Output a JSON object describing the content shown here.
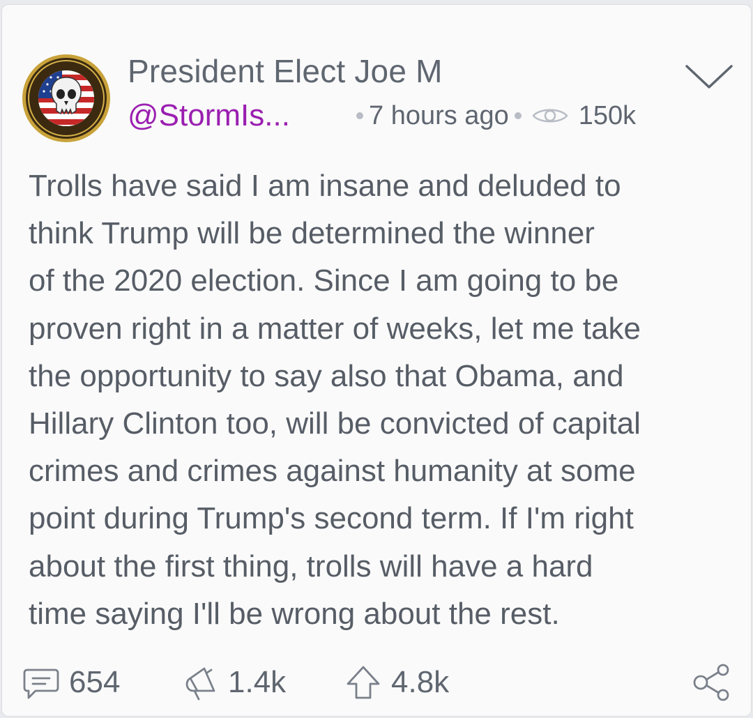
{
  "post": {
    "author_name": "President Elect Joe M",
    "handle": "@StormIs...",
    "time_ago": "7 hours ago",
    "views": "150k",
    "avatar_icon": "punisher-skull-flag-badge-icon",
    "body_lines": [
      "Trolls have said I am insane and deluded to",
      "think Trump will be determined the winner",
      "of the 2020 election. Since I am going to be",
      "proven right in a matter of weeks, let me take",
      "the opportunity to say also that Obama, and",
      "Hillary Clinton too, will be convicted of capital",
      "crimes and crimes against humanity at some",
      "point during Trump's second term. If I'm right",
      "about the first thing, trolls will have a hard",
      "time saying I'll be wrong about the rest."
    ]
  },
  "actions": {
    "comments": "654",
    "reposts": "1.4k",
    "upvotes": "4.8k"
  },
  "colors": {
    "handle": "#9a1fb0",
    "text": "#575d66",
    "meta": "#5f6670",
    "background": "#fafafa"
  }
}
